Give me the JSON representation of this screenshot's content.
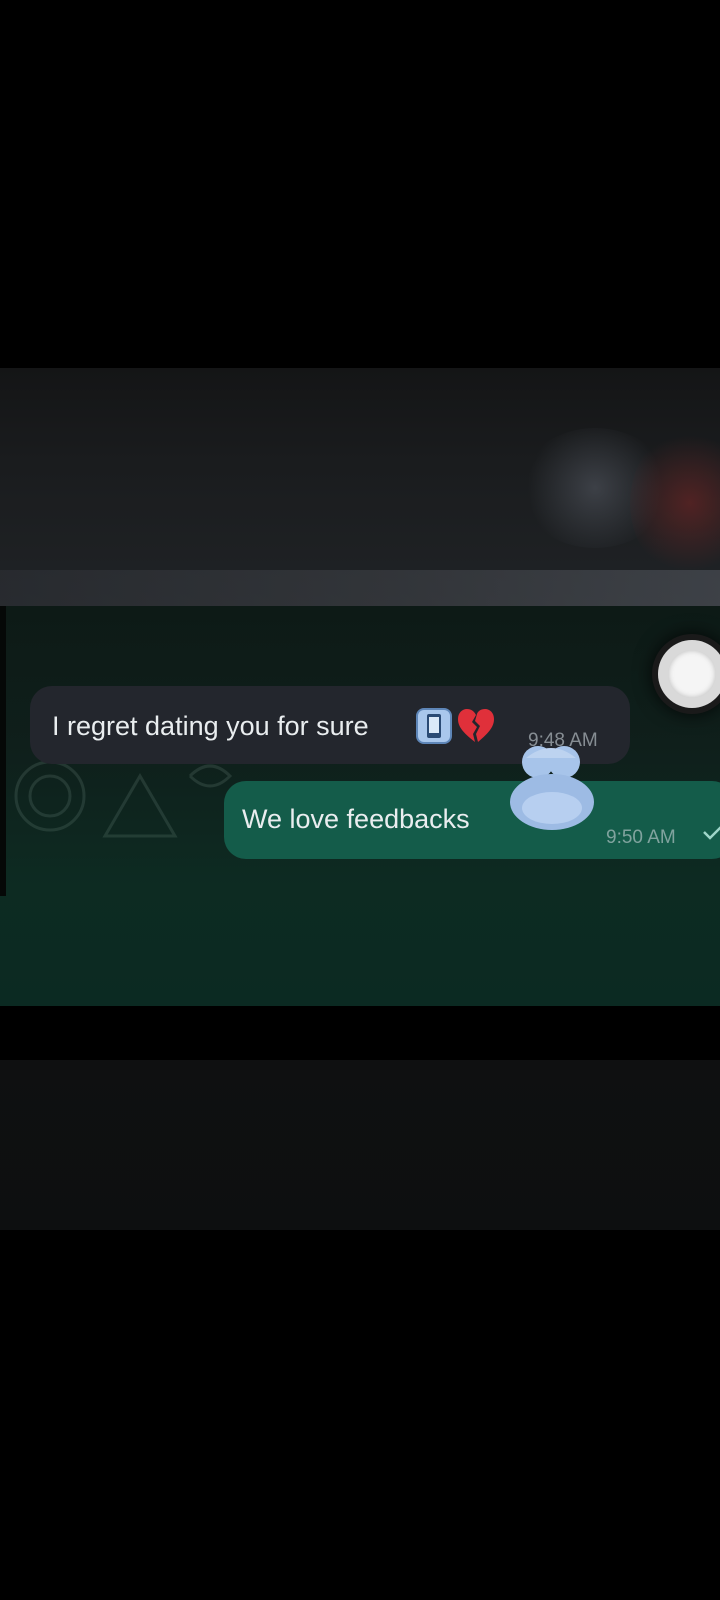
{
  "chat": {
    "messages": [
      {
        "direction": "incoming",
        "text": "I regret dating you for sure",
        "emojis": [
          "mobile-phone-emoji",
          "broken-heart-emoji"
        ],
        "time": "9:48 AM"
      },
      {
        "direction": "outgoing",
        "text": "We love feedbacks",
        "sticker": "hugging-couple-sticker",
        "time": "9:50 AM",
        "status": "sent-check"
      }
    ]
  },
  "colors": {
    "incoming_bubble": "#23262d",
    "outgoing_bubble": "#145c4a",
    "chat_background": "#0d2b22",
    "message_text": "#e9edef",
    "broken_heart": "#e0303a"
  },
  "icons": {
    "floating_button": "screen-record-button-icon",
    "check": "check-icon"
  }
}
